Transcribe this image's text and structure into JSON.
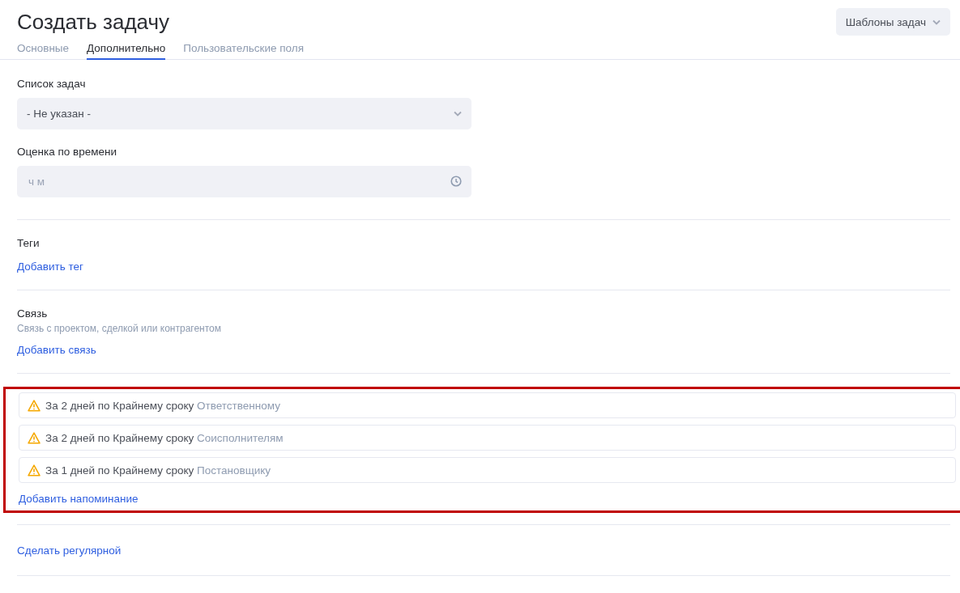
{
  "title": "Создать задачу",
  "templates_button": "Шаблоны задач",
  "tabs": [
    {
      "label": "Основные",
      "selected": false
    },
    {
      "label": "Дополнительно",
      "selected": true
    },
    {
      "label": "Пользовательские поля",
      "selected": false
    }
  ],
  "task_list": {
    "label": "Список задач",
    "value": "- Не указан -"
  },
  "time_estimate": {
    "label": "Оценка по времени",
    "placeholder": "ч м"
  },
  "tags": {
    "label": "Теги",
    "link": "Добавить тег"
  },
  "relation": {
    "label": "Связь",
    "hint": "Связь с проектом, сделкой или контрагентом",
    "link": "Добавить связь"
  },
  "reminders": {
    "highlighted": true,
    "items": [
      {
        "text": "За 2 дней по Крайнему сроку",
        "recipient": "Ответственному"
      },
      {
        "text": "За 2 дней по Крайнему сроку",
        "recipient": "Соисполнителям"
      },
      {
        "text": "За 1 дней по Крайнему сроку",
        "recipient": "Постановщику"
      }
    ],
    "link": "Добавить напоминание"
  },
  "recurring_link": "Сделать регулярной"
}
